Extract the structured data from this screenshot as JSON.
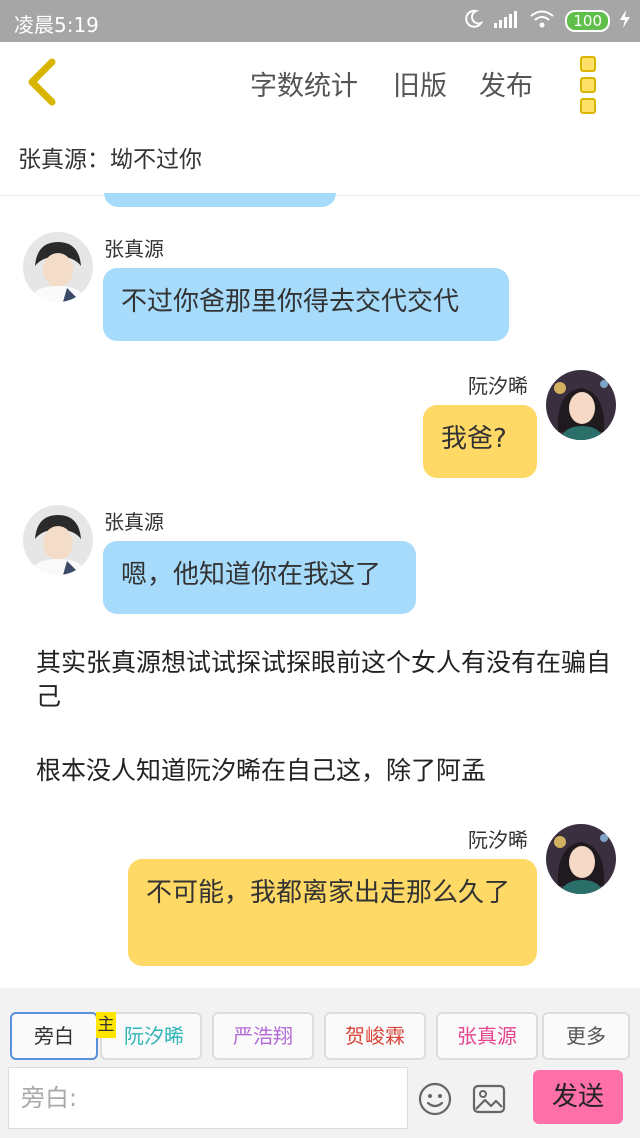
{
  "status_bar": {
    "time": "凌晨5:19",
    "battery": "100"
  },
  "header": {
    "word_count": "字数统计",
    "old_version": "旧版",
    "publish": "发布"
  },
  "subtitle": "张真源：坳不过你",
  "messages": [
    {
      "sender": "张真源",
      "text": "不过你爸那里你得去交代交代"
    },
    {
      "sender": "阮汐晞",
      "text": "我爸?"
    },
    {
      "sender": "张真源",
      "text": "嗯，他知道你在我这了"
    },
    {
      "narration": "其实张真源想试试探试探眼前这个女人有没有在骗自己"
    },
    {
      "narration": "根本没人知道阮汐晞在自己这，除了阿孟"
    },
    {
      "sender": "阮汐晞",
      "text": "不可能，我都离家出走那么久了"
    }
  ],
  "roles": [
    {
      "label": "旁白",
      "color": "#555555"
    },
    {
      "label": "阮汐晞",
      "color": "#2fb4b8",
      "badge": "主"
    },
    {
      "label": "严浩翔",
      "color": "#b36ad6"
    },
    {
      "label": "贺峻霖",
      "color": "#d9463b"
    },
    {
      "label": "张真源",
      "color": "#e4458f"
    },
    {
      "label": "更多",
      "color": "#555555"
    }
  ],
  "input": {
    "placeholder": "旁白:"
  },
  "send_label": "发送"
}
